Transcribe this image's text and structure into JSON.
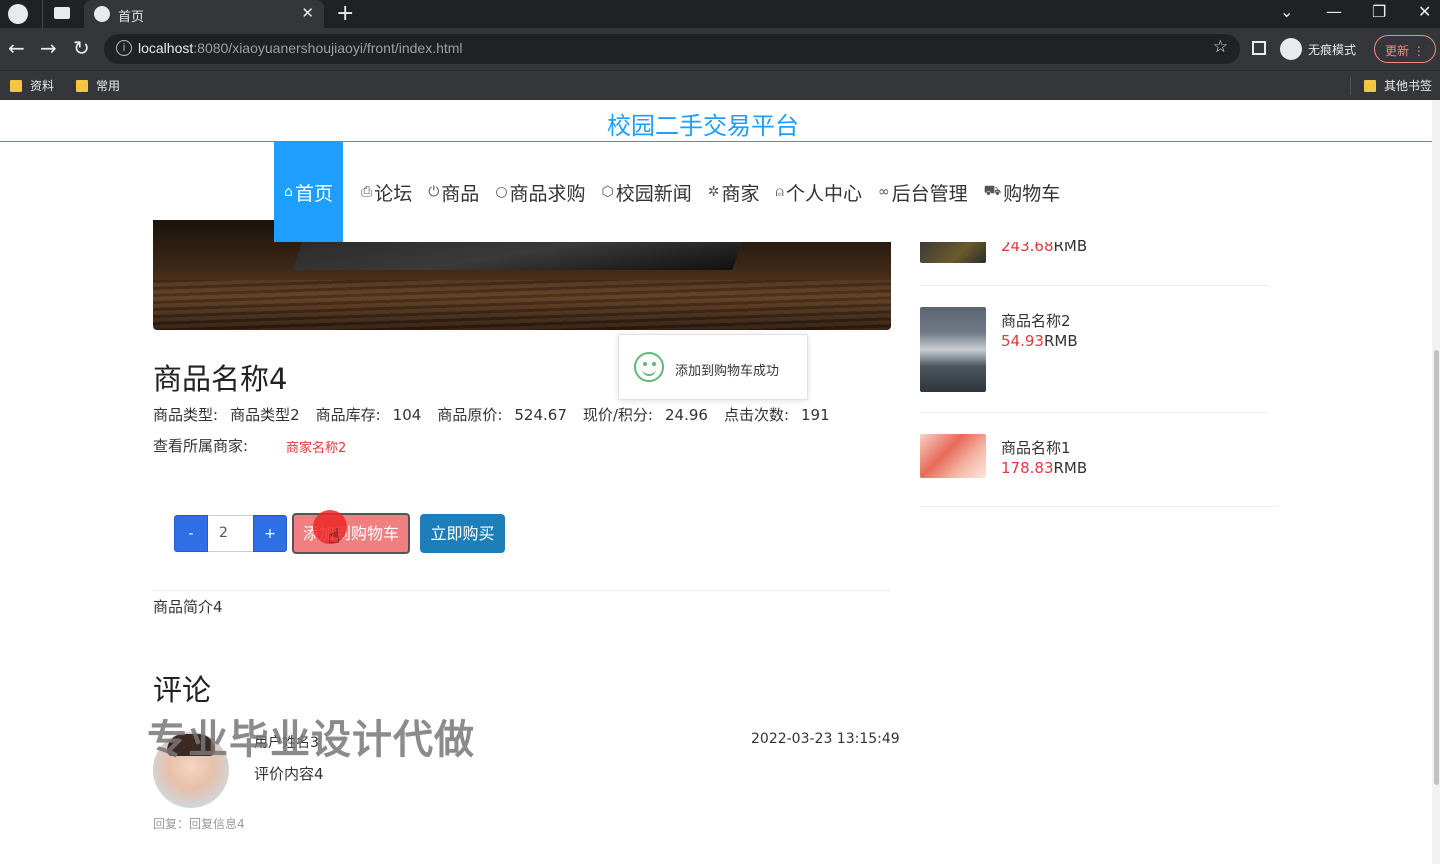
{
  "browser": {
    "tab_title": "首页",
    "url_host": "localhost",
    "url_rest": ":8080/xiaoyuanershoujiaoyi/front/index.html",
    "incognito_label": "无痕模式",
    "update_label": "更新",
    "bookmarks": [
      "资料",
      "常用"
    ],
    "other_bookmarks": "其他书签"
  },
  "site": {
    "title": "校园二手交易平台",
    "nav": [
      {
        "icon": "home-icon",
        "label": "首页"
      },
      {
        "icon": "forum-icon",
        "label": "论坛"
      },
      {
        "icon": "power-icon",
        "label": "商品"
      },
      {
        "icon": "circle-icon",
        "label": "商品求购"
      },
      {
        "icon": "cube-icon",
        "label": "校园新闻"
      },
      {
        "icon": "gear-icon",
        "label": "商家"
      },
      {
        "icon": "user-icon",
        "label": "个人中心"
      },
      {
        "icon": "link-icon",
        "label": "后台管理"
      },
      {
        "icon": "cart-icon",
        "label": "购物车"
      }
    ]
  },
  "product": {
    "name": "商品名称4",
    "type_label": "商品类型:",
    "type_value": "商品类型2",
    "stock_label": "商品库存:",
    "stock_value": "104",
    "orig_price_label": "商品原价:",
    "orig_price_value": "524.67",
    "price_label": "现价/积分:",
    "price_value": "24.96",
    "clicks_label": "点击次数:",
    "clicks_value": "191",
    "merchant_label": "查看所属商家:",
    "merchant_value": "商家名称2",
    "quantity": "2",
    "minus_label": "-",
    "plus_label": "+",
    "add_cart_label": "添加到购物车",
    "buy_now_label": "立即购买",
    "intro": "商品简介4"
  },
  "toast": {
    "message": "添加到购物车成功"
  },
  "comments": {
    "title": "评论",
    "watermark": "专业毕业设计代做",
    "items": [
      {
        "user": "用户姓名3",
        "time": "2022-03-23 13:15:49",
        "content": "评价内容4",
        "reply": "回复：回复信息4"
      }
    ]
  },
  "recommendations": [
    {
      "name": "",
      "price": "243.68",
      "unit": "RMB"
    },
    {
      "name": "商品名称2",
      "price": "54.93",
      "unit": "RMB"
    },
    {
      "name": "商品名称1",
      "price": "178.83",
      "unit": "RMB"
    }
  ],
  "colors": {
    "accent": "#1e9fff",
    "price_red": "#e4393c",
    "cart_button": "#f08080",
    "buy_button": "#1e7fb8",
    "qty_button": "#2f6fe6"
  }
}
